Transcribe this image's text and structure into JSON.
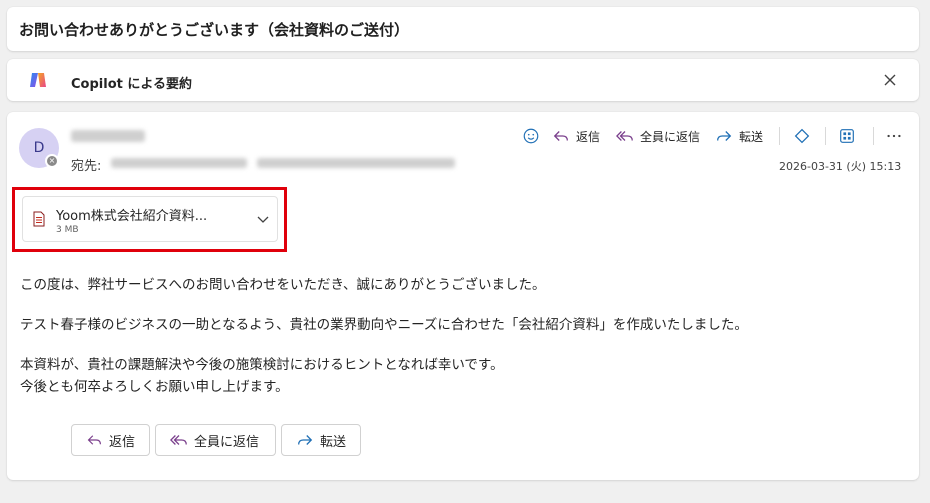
{
  "subject": "お問い合わせありがとうございます（会社資料のご送付）",
  "copilot": {
    "label": "Copilot による要約"
  },
  "message": {
    "avatar_initial": "D",
    "to_label": "宛先:",
    "date": "2026-03-31 (火) 15:13",
    "toolbar": {
      "reply": "返信",
      "reply_all": "全員に返信",
      "forward": "転送"
    },
    "attachment": {
      "name": "Yoom株式会社紹介資料...",
      "size": "3 MB"
    },
    "body": [
      "この度は、弊社サービスへのお問い合わせをいただき、誠にありがとうございました。",
      "テスト春子様のビジネスの一助となるよう、貴社の業界動向やニーズに合わせた「会社紹介資料」を作成いたしました。",
      "本資料が、貴社の課題解決や今後の施策検討におけるヒントとなれば幸いです。",
      "今後とも何卒よろしくお願い申し上げます。"
    ],
    "actions": {
      "reply": "返信",
      "reply_all": "全員に返信",
      "forward": "転送"
    }
  },
  "colors": {
    "reply_icon": "#7a3f8c",
    "forward_icon": "#1f6fb5",
    "highlight": "#e0000b",
    "avatar_bg": "#d6d1f3"
  }
}
